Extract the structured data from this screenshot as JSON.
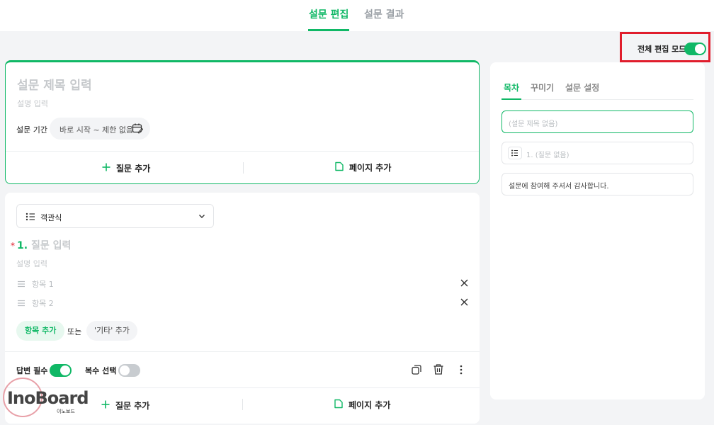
{
  "tabs": [
    {
      "label": "설문 편집",
      "active": true
    },
    {
      "label": "설문 결과",
      "active": false
    }
  ],
  "edit_mode": {
    "label": "전체 편집 모드",
    "enabled": true
  },
  "survey": {
    "title_placeholder": "설문 제목 입력",
    "desc_placeholder": "설명 입력",
    "period_label": "설문 기간",
    "period_value": "바로 시작 ~ 제한 없음",
    "add_question": "질문 추가",
    "add_page": "페이지 추가"
  },
  "question": {
    "type": "객관식",
    "required_mark": "*",
    "number": "1.",
    "title_placeholder": "질문 입력",
    "desc_placeholder": "설명 입력",
    "options": [
      "항목 1",
      "항목 2"
    ],
    "add_option": "항목 추가",
    "or": "또는",
    "add_other": "'기타' 추가",
    "required_label": "답변 필수",
    "required_on": true,
    "multi_label": "복수 선택",
    "multi_on": false,
    "add_question": "질문 추가",
    "add_page": "페이지 추가"
  },
  "sidebar": {
    "tabs": [
      "목차",
      "꾸미기",
      "설문 설정"
    ],
    "title_item": "(설문 제목 없음)",
    "question_item": "1. (질문 없음)",
    "thanks_item": "설문에 참여해 주셔서 감사합니다."
  },
  "watermark": {
    "logo": "InoBoard",
    "sub": "이노보드"
  },
  "colors": {
    "accent": "#10b866",
    "highlight_border": "#e01d2c",
    "required": "#e01d2c"
  }
}
